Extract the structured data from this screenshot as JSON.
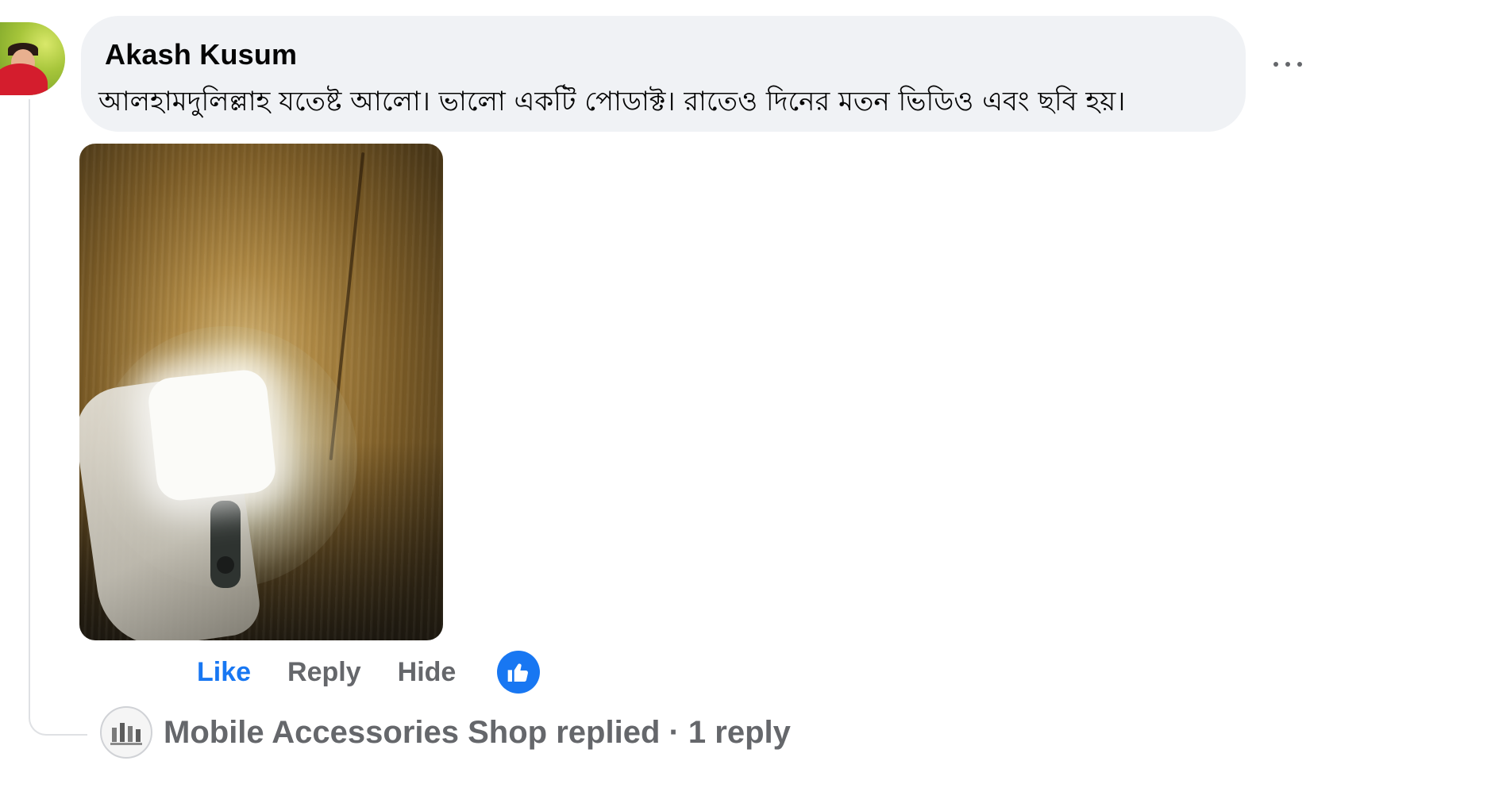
{
  "comment": {
    "author": "Akash Kusum",
    "text": "আলহামদুলিল্লাহ যতেষ্ট আলো। ভালো একটি পোডাক্ট। রাতেও দিনের মতন ভিডিও এবং ছবি হয়।"
  },
  "actions": {
    "like": "Like",
    "reply": "Reply",
    "hide": "Hide"
  },
  "reply_summary": {
    "text": "Mobile Accessories Shop replied · 1 reply"
  },
  "colors": {
    "bubble": "#f0f2f5",
    "accent": "#1877f2",
    "secondary_text": "#65676b"
  },
  "icons": {
    "more": "more-options-icon",
    "reaction": "thumbs-up-icon"
  }
}
